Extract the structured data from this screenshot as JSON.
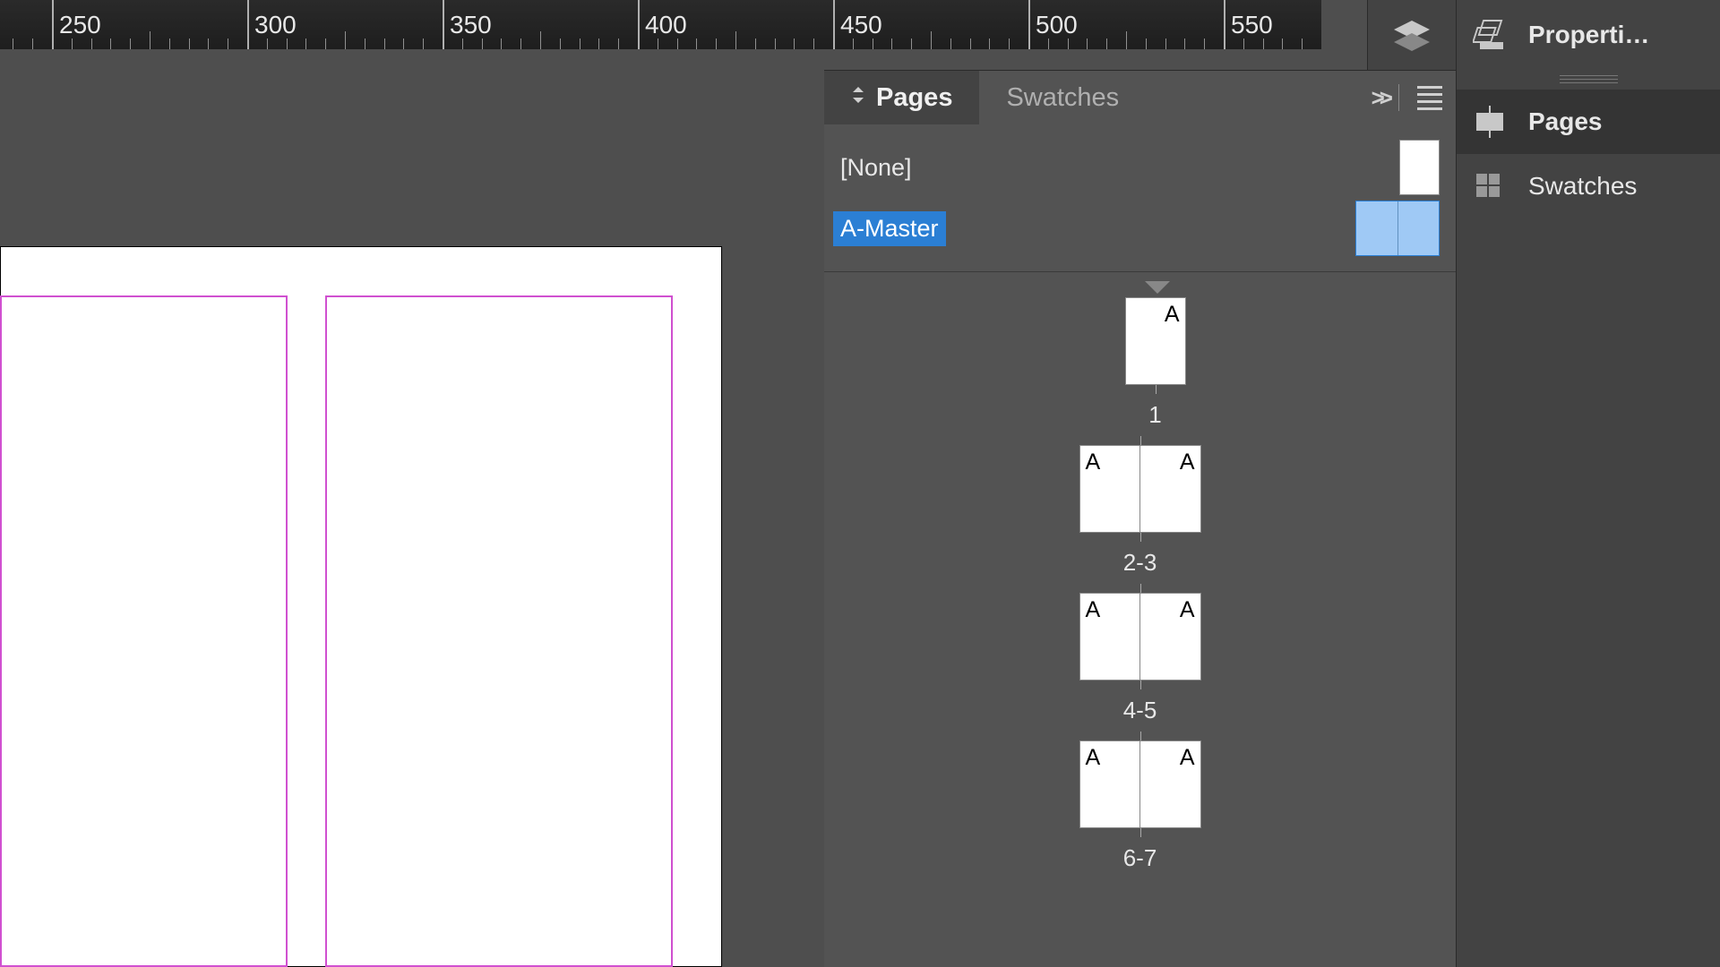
{
  "ruler": {
    "ticks": [
      250,
      300,
      350,
      400,
      450,
      500,
      550
    ]
  },
  "panel": {
    "tabs": {
      "pages": "Pages",
      "swatches": "Swatches"
    }
  },
  "masters": {
    "none": "[None]",
    "a_master": "A-Master"
  },
  "pages": {
    "letter": "A",
    "items": [
      {
        "label": "1",
        "type": "single"
      },
      {
        "label": "2-3",
        "type": "spread"
      },
      {
        "label": "4-5",
        "type": "spread"
      },
      {
        "label": "6-7",
        "type": "spread"
      }
    ]
  },
  "sidebar": {
    "properties": "Properti…",
    "pages": "Pages",
    "swatches": "Swatches"
  }
}
